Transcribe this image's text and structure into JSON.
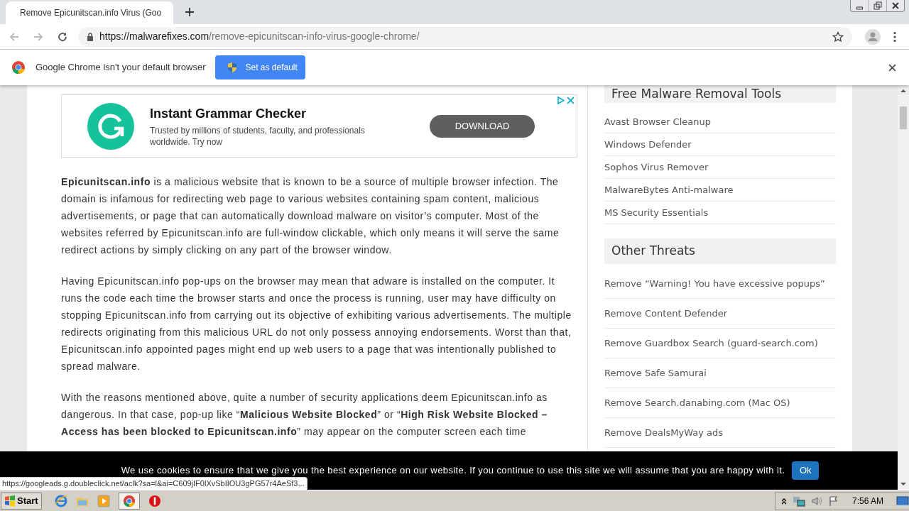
{
  "tab": {
    "title": "Remove Epicunitscan.info Virus (Goo",
    "selected": true
  },
  "address": {
    "host": "https://malwarefixes.com",
    "path": "/remove-epicunitscan-info-virus-google-chrome/"
  },
  "infobar": {
    "message": "Google Chrome isn't your default browser",
    "button": "Set as default"
  },
  "ad": {
    "title": "Instant Grammar Checker",
    "description": "Trusted by millions of students, faculty, and professionals worldwide. Try now",
    "button": "DOWNLOAD"
  },
  "article": [
    "**Epicunitscan.info** is a malicious website that is known to be a source of multiple browser infection. The domain is infamous for redirecting web page to various websites containing spam content, malicious advertisements, or page that can automatically download malware on visitor’s computer. Most of the websites referred by Epicunitscan.info are full-window clickable, which only means it will serve the same redirect actions by simply clicking on any part of the browser window.",
    "Having Epicunitscan.info pop-ups on the browser may mean that adware is installed on the computer. It runs the code each time the browser starts and once the process is running, user may have difficulty on stopping Epicunitscan.info from carrying out its objective of exhibiting various advertisements. The multiple redirects originating from this malicious URL do not only possess annoying endorsements. Worst than that, Epicunitscan.info appointed pages might end up web users to a page that was intentionally published to spread malware.",
    "With the reasons mentioned above, quite a number of security applications deem Epicunitscan.info as dangerous. In that case, pop-up like “**Malicious Website Blocked**” or “**High Risk Website Blocked – Access has been blocked to Epicunitscan.info**” may appear on the computer screen each time"
  ],
  "sidebar": [
    {
      "heading": "Free Malware Removal Tools",
      "links": [
        "Avast Browser Cleanup",
        "Windows Defender",
        "Sophos Virus Remover",
        "MalwareBytes Anti-malware",
        "MS Security Essentials"
      ]
    },
    {
      "heading": "Other Threats",
      "links": [
        "Remove “Warning! You have excessive popups”",
        "Remove Content Defender",
        "Remove Guardbox Search (guard-search.com)",
        "Remove Safe Samurai",
        "Remove Search.danabing.com (Mac OS)",
        "Remove DealsMyWay ads"
      ]
    }
  ],
  "cookie_bar": {
    "message": "We use cookies to ensure that we give you the best experience on our website. If you continue to use this site we will assume that you are happy with it.",
    "button": "Ok"
  },
  "status_link": "https://googleads.g.doubleclick.net/aclk?sa=l&ai=C609jIF0lXvSbIIOU3gPG57r4AeSf3...",
  "taskbar": {
    "start": "Start",
    "clock": "7:56 AM"
  }
}
